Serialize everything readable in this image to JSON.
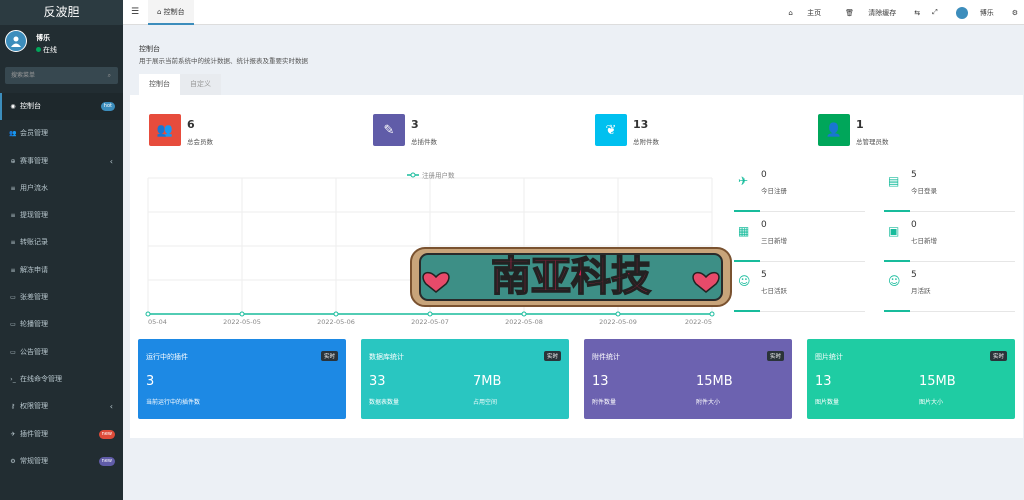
{
  "app": {
    "logo": "反波胆"
  },
  "user": {
    "name": "博乐",
    "status": "在线"
  },
  "search": {
    "placeholder": "搜索菜单"
  },
  "menu": [
    {
      "label": "控制台",
      "badge": "hot",
      "badge_color": "#3c8dbc"
    },
    {
      "label": "会员管理"
    },
    {
      "label": "赛事管理",
      "arrow": "‹"
    },
    {
      "label": "用户流水"
    },
    {
      "label": "提现管理"
    },
    {
      "label": "转账记录"
    },
    {
      "label": "解冻申请"
    },
    {
      "label": "张差管理"
    },
    {
      "label": "轮播管理"
    },
    {
      "label": "公告管理"
    },
    {
      "label": "在线命令管理"
    },
    {
      "label": "权限管理",
      "arrow": "‹"
    },
    {
      "label": "插件管理",
      "badge": "new",
      "badge_color": "#dd4b39"
    },
    {
      "label": "常规管理",
      "badge": "new",
      "badge_color": "#605ca8"
    }
  ],
  "topbar": {
    "tab": "控制台",
    "home": "主页",
    "clear_cache": "清除缓存",
    "user": "博乐"
  },
  "page": {
    "title": "控制台",
    "desc": "用于展示当前系统中的统计数据、统计报表及重要实时数据",
    "tabs": [
      "控制台",
      "自定义"
    ]
  },
  "stats": [
    {
      "num": "6",
      "label": "总会员数",
      "color": "#e74c3c",
      "icon": "users-icon"
    },
    {
      "num": "3",
      "label": "总插件数",
      "color": "#605ca8",
      "icon": "magic-wand-icon"
    },
    {
      "num": "13",
      "label": "总附件数",
      "color": "#00c0ef",
      "icon": "leaf-icon"
    },
    {
      "num": "1",
      "label": "总管理员数",
      "color": "#00a65a",
      "icon": "user-icon"
    }
  ],
  "chart_data": {
    "type": "line",
    "legend": "注册用户数",
    "categories": [
      "05-04",
      "2022-05-05",
      "2022-05-06",
      "2022-05-07",
      "2022-05-08",
      "2022-05-09",
      "2022-05"
    ],
    "series": [
      {
        "name": "注册用户数",
        "values": [
          0,
          0,
          0,
          0,
          0,
          0,
          0
        ]
      }
    ]
  },
  "small_stats": [
    {
      "num": "0",
      "label": "今日注册",
      "icon": "rocket-icon"
    },
    {
      "num": "5",
      "label": "今日登录",
      "icon": "id-card-icon"
    },
    {
      "num": "0",
      "label": "三日新增",
      "icon": "calendar-icon"
    },
    {
      "num": "0",
      "label": "七日新增",
      "icon": "calendar-plus-icon"
    },
    {
      "num": "5",
      "label": "七日活跃",
      "icon": "user-circle-icon"
    },
    {
      "num": "5",
      "label": "月活跃",
      "icon": "user-circle-icon"
    }
  ],
  "cards": [
    {
      "title": "运行中的插件",
      "badge": "实时",
      "v1": "3",
      "v2": "",
      "s1": "当前运行中的插件数",
      "s2": "",
      "color": "#1d89e4"
    },
    {
      "title": "数据库统计",
      "badge": "实时",
      "v1": "33",
      "v2": "7MB",
      "s1": "数据表数量",
      "s2": "占用空间",
      "color": "#29c6c1"
    },
    {
      "title": "附件统计",
      "badge": "实时",
      "v1": "13",
      "v2": "15MB",
      "s1": "附件数量",
      "s2": "附件大小",
      "color": "#6c62b0"
    },
    {
      "title": "图片统计",
      "badge": "实时",
      "v1": "13",
      "v2": "15MB",
      "s1": "图片数量",
      "s2": "图片大小",
      "color": "#1fcca3"
    }
  ],
  "watermark": {
    "text": "南亚科技"
  }
}
